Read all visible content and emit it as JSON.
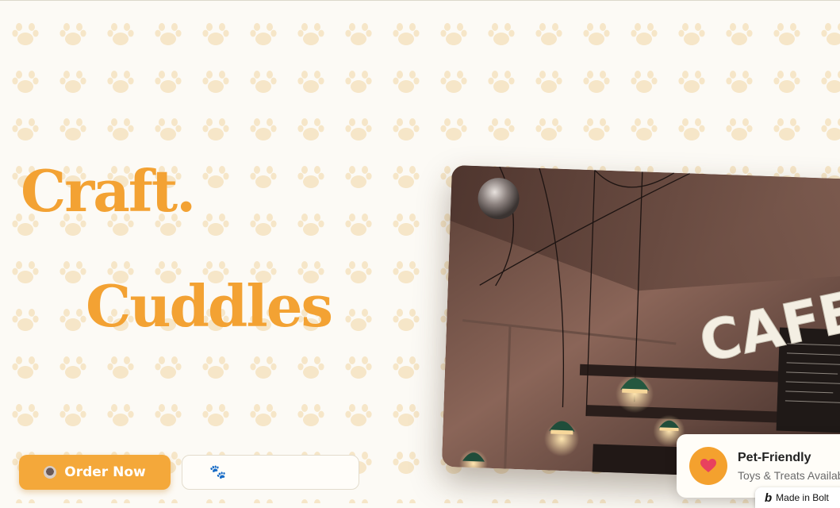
{
  "hero": {
    "line1": "Craft.",
    "line2": "Cuddles"
  },
  "actions": {
    "order_label": "Order Now",
    "order_icon": "coffee-cup-icon",
    "secondary_icon": "paw-icon",
    "secondary_glyph": "🐾"
  },
  "badge": {
    "title": "Pet-Friendly",
    "subtitle": "Toys & Treats Available",
    "icon": "heart-icon"
  },
  "footer_badge": {
    "mark": "b",
    "text": "Made in Bolt"
  },
  "photo": {
    "sign_text": "CAFE",
    "subject": "cafe interior with hanging green pendant lamps"
  },
  "colors": {
    "accent": "#f3a233",
    "button": "#f4a83a",
    "background": "#fcfaf5",
    "paw_pattern": "#f6e6c8",
    "heart": "#e8415e"
  }
}
